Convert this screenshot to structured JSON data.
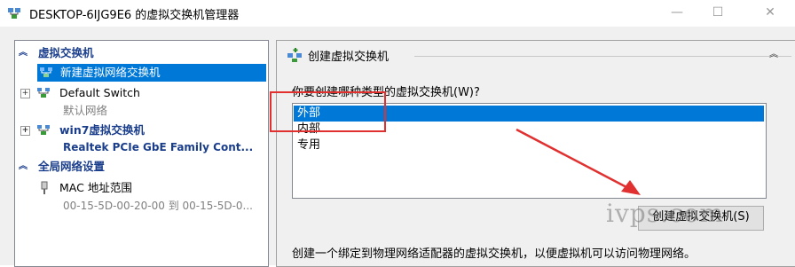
{
  "window": {
    "title": "DESKTOP-6IJG9E6 的虚拟交换机管理器",
    "minimize": "—",
    "maximize": "☐",
    "close": "✕"
  },
  "tree": {
    "virtual_switches_header": "虚拟交换机",
    "new_switch": "新建虚拟网络交换机",
    "default_switch": "Default Switch",
    "default_switch_sub": "默认网络",
    "win7_switch": "win7虚拟交换机",
    "win7_switch_sub": "Realtek PCIe GbE Family Cont...",
    "global_settings_header": "全局网络设置",
    "mac_range": "MAC 地址范围",
    "mac_range_sub": "00-15-5D-00-20-00 到 00-15-5D-0..."
  },
  "panel": {
    "section_title": "创建虚拟交换机",
    "question": "你要创建哪种类型的虚拟交换机(W)?",
    "types": [
      "外部",
      "内部",
      "专用"
    ],
    "selected_type": "外部",
    "create_button": "创建虚拟交换机(S)",
    "description": "创建一个绑定到物理网络适配器的虚拟交换机，以便虚拟机可以访问物理网络。"
  },
  "overlay": {
    "watermark": "ivps.com",
    "annotation_color": "#e03030"
  }
}
